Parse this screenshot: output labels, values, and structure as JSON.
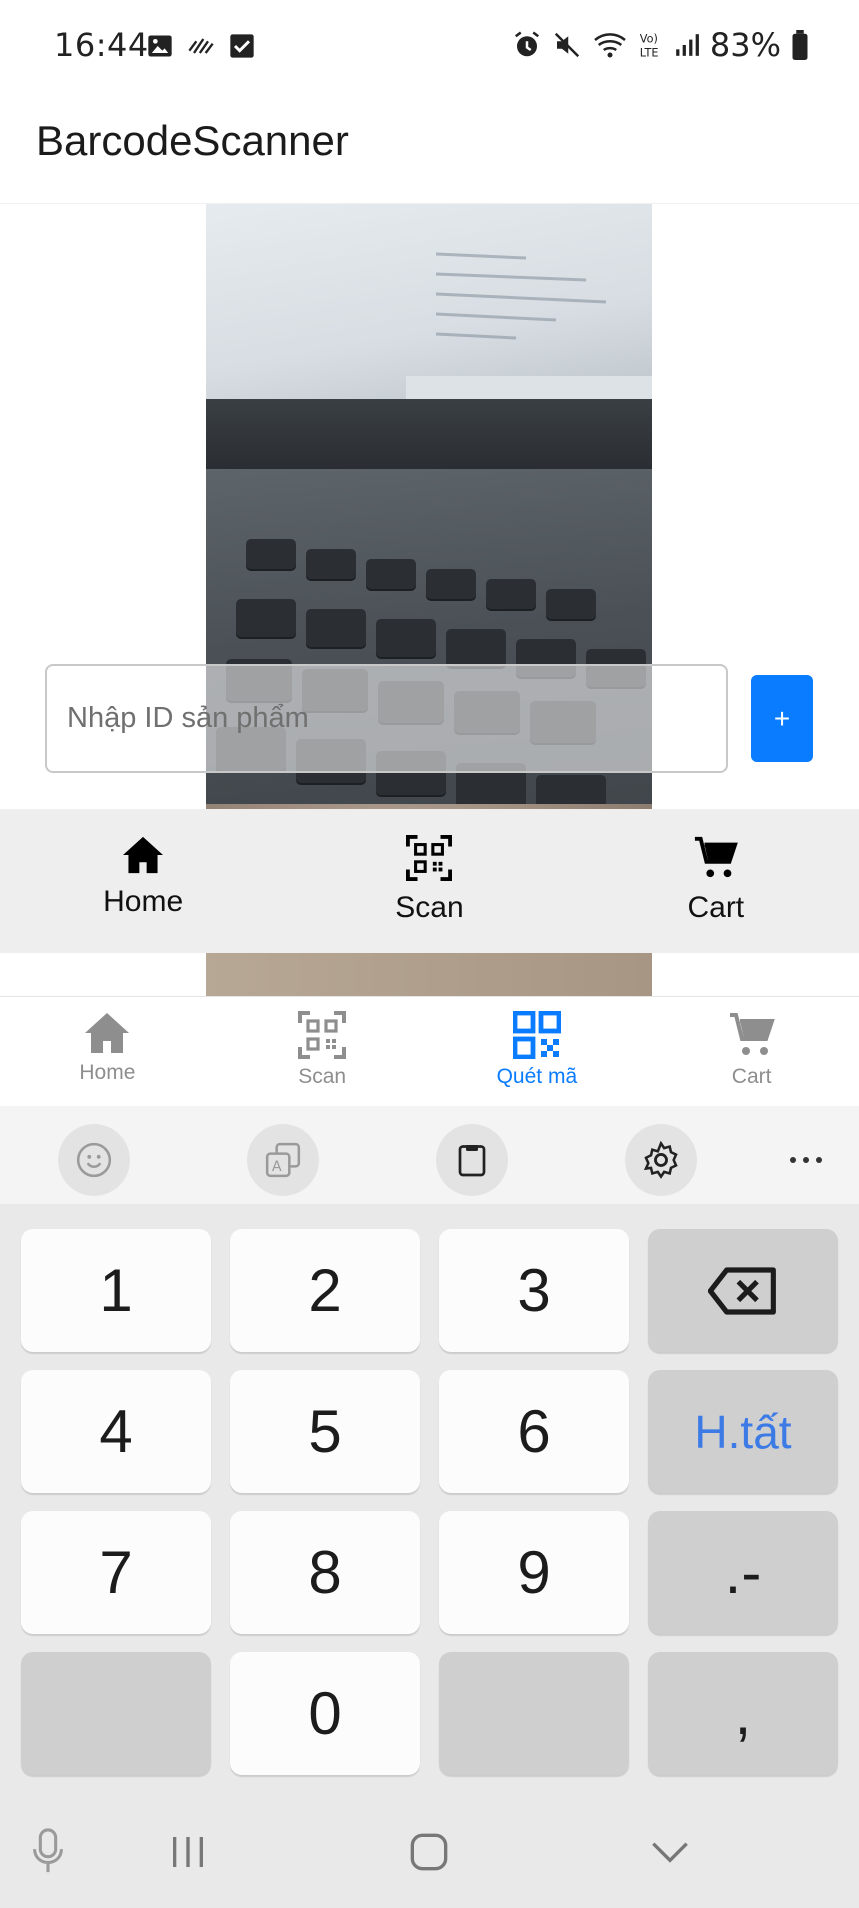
{
  "status_bar": {
    "time": "16:44",
    "battery": "83%",
    "left_icons": [
      "image-icon",
      "signal-activity-icon",
      "checkbox-icon"
    ],
    "right_icons": [
      "alarm-icon",
      "mute-icon",
      "wifi-6-icon",
      "volte-icon",
      "cell-signal-icon",
      "battery-icon"
    ]
  },
  "app_bar": {
    "title": "BarcodeScanner"
  },
  "product_input": {
    "placeholder": "Nhập ID sản phẩm",
    "value": ""
  },
  "add_button": {
    "label": "+"
  },
  "inner_tabs": [
    {
      "label": "Home",
      "icon": "home-icon"
    },
    {
      "label": "Scan",
      "icon": "qr-scan-icon"
    },
    {
      "label": "Cart",
      "icon": "cart-icon"
    }
  ],
  "bottom_nav": {
    "items": [
      {
        "label": "Home",
        "icon": "home-icon",
        "active": false
      },
      {
        "label": "Scan",
        "icon": "qr-scan-icon",
        "active": false
      },
      {
        "label": "Quét mã",
        "icon": "qr-code-icon",
        "active": true
      },
      {
        "label": "Cart",
        "icon": "cart-icon",
        "active": false
      }
    ],
    "active_color": "#0a7cff",
    "inactive_color": "#8e8e8e"
  },
  "keyboard_toolbar": [
    "emoji-icon",
    "translate-icon",
    "clipboard-icon",
    "settings-icon",
    "more-icon"
  ],
  "keyboard": {
    "keys": [
      [
        "1",
        "2",
        "3",
        ""
      ],
      [
        "4",
        "5",
        "6",
        "H.tất"
      ],
      [
        "7",
        "8",
        "9",
        ".-"
      ],
      [
        "",
        "0",
        "",
        ","
      ]
    ],
    "backspace_icon": "backspace-icon"
  },
  "system_nav": [
    "mic-icon",
    "recents-icon",
    "home-nav-icon",
    "hide-keyboard-icon"
  ],
  "accent_color": "#0a7cff"
}
